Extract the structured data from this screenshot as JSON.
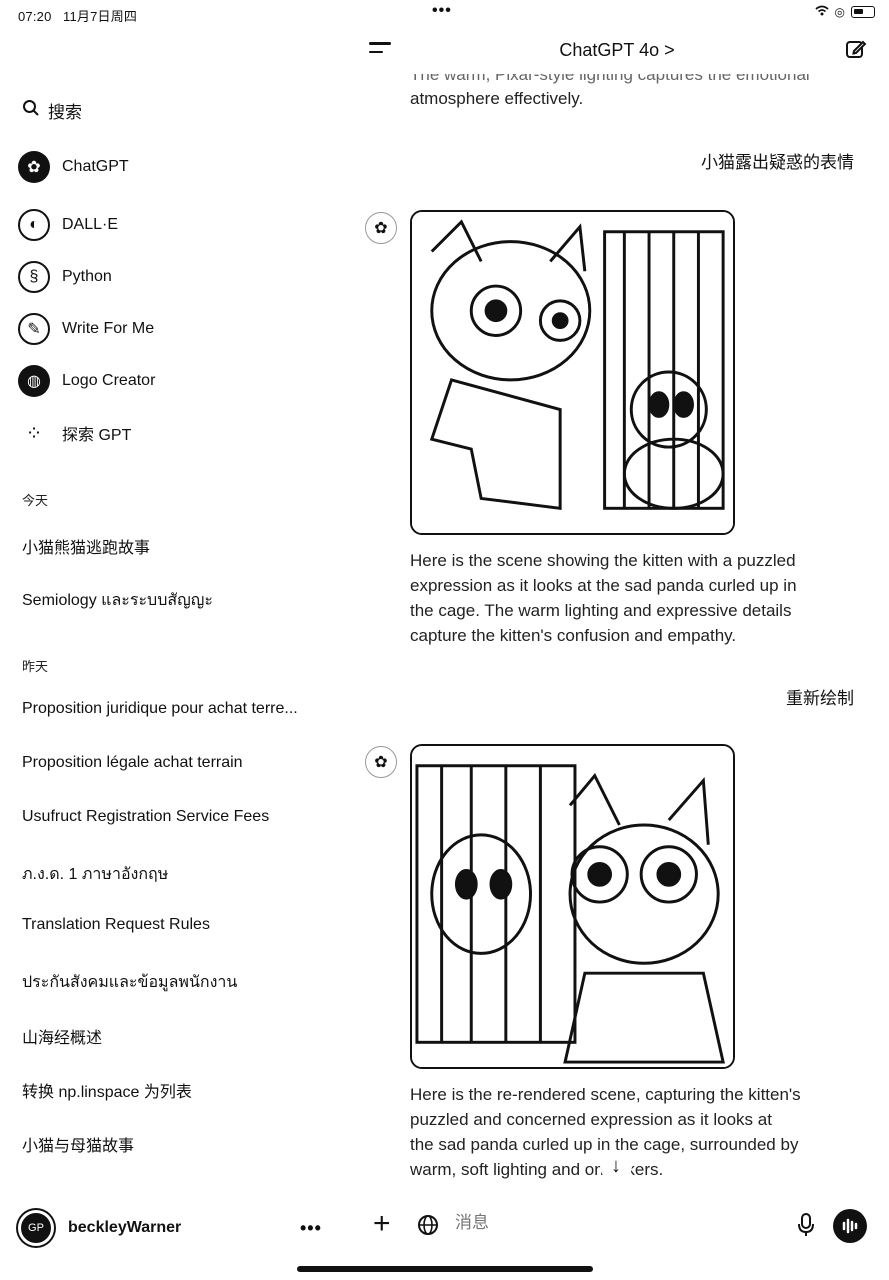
{
  "status_bar": {
    "time": "07:20",
    "date": "11月7日周四",
    "center_dots": "•••"
  },
  "sidebar": {
    "search_label": "搜索",
    "gpts": [
      {
        "label": "ChatGPT",
        "icon": "chatgpt-logo-icon"
      },
      {
        "label": "DALL·E",
        "icon": "dalle-icon"
      },
      {
        "label": "Python",
        "icon": "python-icon"
      },
      {
        "label": "Write For Me",
        "icon": "pen-icon"
      },
      {
        "label": "Logo Creator",
        "icon": "logo-creator-icon"
      },
      {
        "label": "探索 GPT",
        "icon": "explore-grid-icon"
      }
    ],
    "today_label": "今天",
    "today_chats": [
      "小猫熊猫逃跑故事",
      "Semiology และระบบสัญญะ"
    ],
    "yesterday_label": "昨天",
    "yesterday_chats": [
      "Proposition juridique pour achat terre...",
      "Proposition légale achat terrain",
      "Usufruct Registration Service Fees",
      "ภ.ง.ด. 1 ภาษาอังกฤษ",
      "Translation Request Rules",
      "ประกันสังคมและข้อมูลพนักงาน",
      "山海经概述",
      "转换 np.linspace 为列表",
      "小猫与母猫故事"
    ],
    "footer": {
      "avatar_initials": "GP",
      "username": "beckleyWarner",
      "more": "•••"
    }
  },
  "main": {
    "model_title": "ChatGPT 4o >",
    "messages": {
      "partial_top_line_1": "The warm, Pixar-style lighting captures the emotional",
      "partial_top_line_2": "atmosphere effectively.",
      "user_1": "小猫露出疑惑的表情",
      "assistant_1_line_1": "Here is the scene showing the kitten with a puzzled",
      "assistant_1_line_2": "expression as it looks at the sad panda curled up in",
      "assistant_1_line_3": "the cage. The warm lighting and expressive details",
      "assistant_1_line_4": "capture the kitten's confusion and empathy.",
      "user_2": "重新绘制",
      "assistant_2_line_1": "Here is the re-rendered scene, capturing the kitten's",
      "assistant_2_line_2": "puzzled and concerned expression as it looks at",
      "assistant_2_line_3": "the sad panda curled up in the cage, surrounded by",
      "assistant_2_line_4": "warm, soft lighting and onlookers."
    },
    "composer": {
      "placeholder": "消息"
    }
  }
}
